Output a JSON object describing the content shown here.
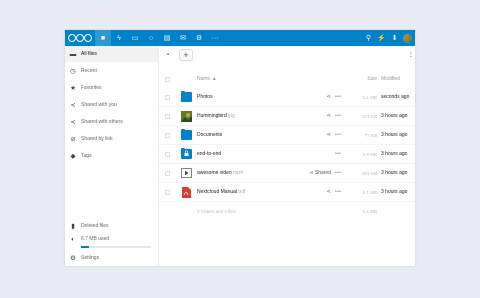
{
  "header": {
    "apps": [
      {
        "icon": "files-icon",
        "glyph": "■",
        "active": true
      },
      {
        "icon": "activity-icon",
        "glyph": "ϟ"
      },
      {
        "icon": "gallery-icon",
        "glyph": "▭"
      },
      {
        "icon": "search-app-icon",
        "glyph": "○"
      },
      {
        "icon": "contacts-icon",
        "glyph": "▤"
      },
      {
        "icon": "mail-icon",
        "glyph": "✉"
      },
      {
        "icon": "integrations-icon",
        "glyph": "⚙"
      },
      {
        "icon": "more-apps-icon",
        "glyph": "···"
      }
    ],
    "right": [
      {
        "icon": "search-icon",
        "glyph": "⚲"
      },
      {
        "icon": "notifications-icon",
        "glyph": "⚡"
      },
      {
        "icon": "download-icon",
        "glyph": "⬇"
      }
    ]
  },
  "sidebar": {
    "items": [
      {
        "label": "All files",
        "icon": "folder-icon",
        "glyph": "▬",
        "active": true
      },
      {
        "label": "Recent",
        "icon": "clock-icon",
        "glyph": "◷"
      },
      {
        "label": "Favorites",
        "icon": "star-icon",
        "glyph": "★"
      },
      {
        "label": "Shared with you",
        "icon": "share-icon",
        "glyph": "≺"
      },
      {
        "label": "Shared with others",
        "icon": "share-icon",
        "glyph": "≺"
      },
      {
        "label": "Shared by link",
        "icon": "link-icon",
        "glyph": "⊘"
      },
      {
        "label": "Tags",
        "icon": "tag-icon",
        "glyph": "◆"
      }
    ],
    "deleted": {
      "label": "Deleted files",
      "icon": "trash-icon",
      "glyph": "▮"
    },
    "quota": {
      "label": "6.7 MB used",
      "icon": "pie-icon",
      "glyph": "◐",
      "fill": 0.12
    },
    "settings": {
      "label": "Settings",
      "icon": "settings-icon",
      "glyph": "⚙"
    }
  },
  "toolbar": {
    "plus": "+"
  },
  "table": {
    "headers": {
      "name": "Name ▲",
      "size": "Size",
      "modified": "Modified"
    },
    "rows": [
      {
        "name": "Photos",
        "ext": "",
        "type": "folder",
        "share": "share",
        "share_label": "",
        "size": "1.1 MB",
        "modified": "seconds ago"
      },
      {
        "name": "Hummingbird",
        "ext": ".jpg",
        "type": "image",
        "share": "share",
        "share_label": "",
        "size": "572 KB",
        "modified": "3 hours ago"
      },
      {
        "name": "Documents",
        "ext": "",
        "type": "folder",
        "share": "share",
        "share_label": "",
        "size": "77 KB",
        "modified": "3 hours ago"
      },
      {
        "name": "end-to-end",
        "ext": "",
        "type": "encrypted-folder",
        "share": "",
        "share_label": "",
        "size": "2.9 MB",
        "modified": "3 hours ago"
      },
      {
        "name": "awesome video",
        "ext": ".mp4",
        "type": "video",
        "share": "share",
        "share_label": "Shared",
        "size": "902 KB",
        "modified": "3 hours ago"
      },
      {
        "name": "Nextcloud Manual",
        "ext": ".pdf",
        "type": "pdf",
        "share": "share",
        "share_label": "",
        "size": "6.1 MB",
        "modified": "3 hours ago"
      }
    ],
    "summary": {
      "text": "3 folders and 3 files",
      "size": "5.1 MB"
    }
  },
  "colors": {
    "accent": "#0082c9",
    "pdf": "#dc3d32"
  }
}
